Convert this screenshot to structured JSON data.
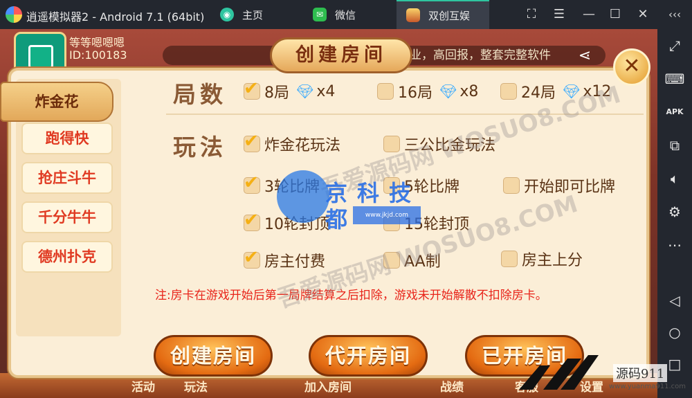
{
  "window": {
    "title": "逍遥模拟器2 - Android 7.1 (64bit)",
    "tabs": [
      {
        "label": "主页",
        "icon": "home-tab-icon"
      },
      {
        "label": "微信",
        "icon": "wechat-icon"
      },
      {
        "label": "双创互娱",
        "icon": "game-app-icon",
        "active": true
      }
    ],
    "controls": [
      "fullscreen-icon",
      "menu-icon",
      "minimize-icon",
      "maximize-icon",
      "close-icon",
      "collapse-sidebar-icon"
    ]
  },
  "sidebar": {
    "items": [
      {
        "name": "expand-screen-icon",
        "glyph": "⤢"
      },
      {
        "name": "keyboard-icon",
        "glyph": "⌨"
      },
      {
        "name": "apk-icon",
        "glyph": "APK"
      },
      {
        "name": "add-window-icon",
        "glyph": "⧉"
      },
      {
        "name": "volume-icon",
        "glyph": "◁)"
      },
      {
        "name": "settings-icon",
        "glyph": "⚙"
      },
      {
        "name": "more-icon",
        "glyph": "⋯"
      },
      {
        "name": "back-icon",
        "glyph": "◁"
      },
      {
        "name": "home-icon",
        "glyph": "○"
      },
      {
        "name": "recent-apps-icon",
        "glyph": "□"
      }
    ]
  },
  "game": {
    "player_name": "等等嗯嗯嗯",
    "player_id": "ID:100183",
    "marquee": "创业，高回报，整套完整软件",
    "bottom_items": [
      "活动",
      "玩法",
      "加入房间",
      "战绩",
      "客服",
      "设置"
    ]
  },
  "dialog": {
    "title": "创建房间",
    "close_glyph": "✕",
    "game_types": [
      {
        "label": "炸金花",
        "active": true
      },
      {
        "label": "跑得快",
        "active": false
      },
      {
        "label": "抢庄斗牛",
        "active": false
      },
      {
        "label": "千分牛牛",
        "active": false
      },
      {
        "label": "德州扑克",
        "active": false
      }
    ],
    "rounds_label": "局数",
    "rounds": [
      {
        "label": "8局",
        "cost": "x4",
        "checked": true
      },
      {
        "label": "16局",
        "cost": "x8",
        "checked": false
      },
      {
        "label": "24局",
        "cost": "x12",
        "checked": false
      }
    ],
    "rules_label": "玩法",
    "rules": [
      {
        "label": "炸金花玩法",
        "checked": true
      },
      {
        "label": "三公比金玩法",
        "checked": false
      },
      {
        "label": "3轮比牌",
        "checked": true
      },
      {
        "label": "5轮比牌",
        "checked": false
      },
      {
        "label": "开始即可比牌",
        "checked": false
      },
      {
        "label": "10轮封顶",
        "checked": true
      },
      {
        "label": "15轮封顶",
        "checked": false
      },
      {
        "label": "房主付费",
        "checked": true
      },
      {
        "label": "AA制",
        "checked": false
      },
      {
        "label": "房主上分",
        "checked": false
      }
    ],
    "note": "注:房卡在游戏开始后第一局牌结算之后扣除，游戏未开始解散不扣除房卡。",
    "buttons": [
      "创建房间",
      "代开房间",
      "已开房间"
    ]
  },
  "watermarks": {
    "center_line1": "京科技",
    "center_line2": "都",
    "center_url": "www.jkjd.com",
    "faint": "吾爱源码网 WOSUO8.COM",
    "corner": "源码911",
    "corner_url": "www.yuanma911.com"
  },
  "colors": {
    "accent_orange": "#e46b12",
    "note_red": "#e8241a",
    "checkbox_tick": "#f5b014",
    "gem_blue": "#31a8ff"
  }
}
